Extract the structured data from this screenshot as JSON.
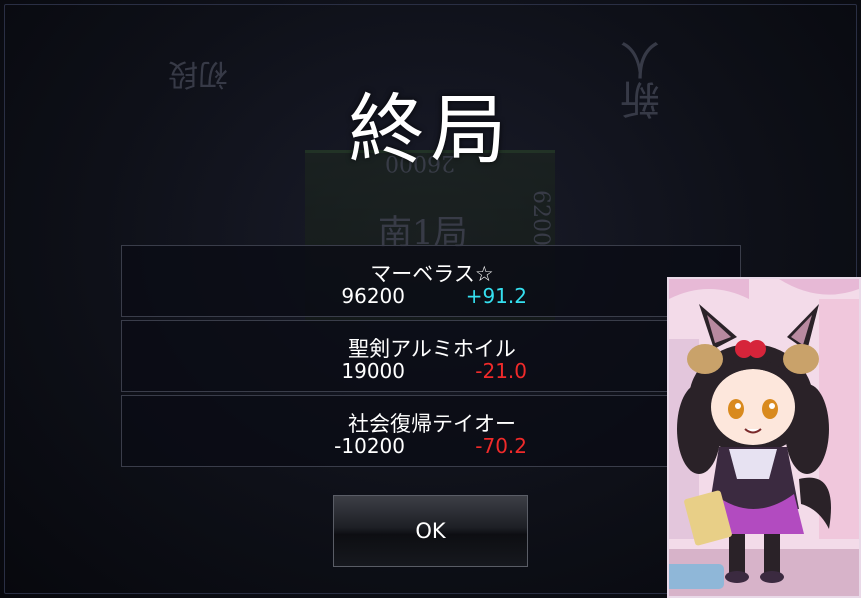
{
  "title": "終局",
  "background": {
    "rank_left": "初段",
    "rank_right": "新人",
    "score_top": "26000",
    "round": "南1局",
    "score_side": "6200"
  },
  "results": [
    {
      "name": "マーベラス☆",
      "score": "96200",
      "delta": "+91.2",
      "delta_sign": "pos"
    },
    {
      "name": "聖剣アルミホイル",
      "score": "19000",
      "delta": "-21.0",
      "delta_sign": "neg"
    },
    {
      "name": "社会復帰テイオー",
      "score": "-10200",
      "delta": "-70.2",
      "delta_sign": "neg"
    }
  ],
  "ok_button": {
    "label": "OK"
  },
  "colors": {
    "positive": "#35e0f0",
    "negative": "#f02a2a",
    "text": "#ffffff"
  },
  "character_card": {
    "icon": "chibi-horse-girl-illustration"
  }
}
